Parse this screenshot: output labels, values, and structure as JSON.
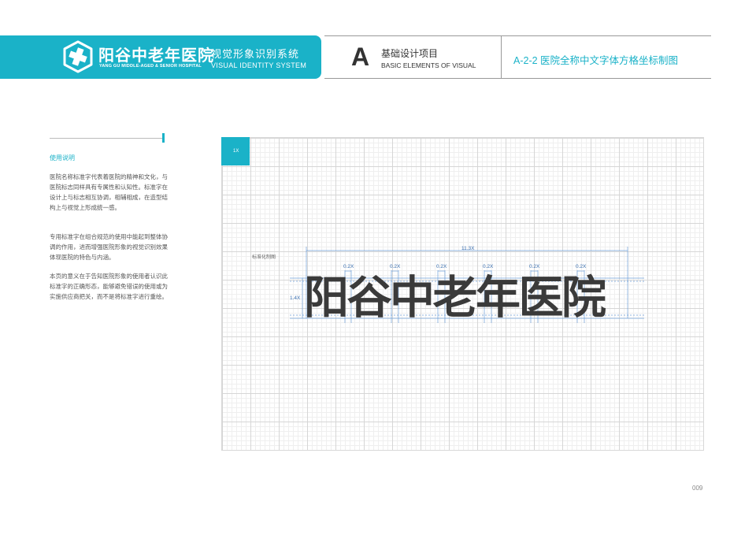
{
  "header": {
    "logo_cn": "阳谷中老年医院",
    "logo_en": "YANG GU MIDDLE-AGED & SENIOR HOSPITAL",
    "system_cn": "视觉形象识别系统",
    "system_en": "VISUAL IDENTITY SYSTEM",
    "section_letter": "A",
    "section_cn": "基础设计项目",
    "section_en": "BASIC ELEMENTS OF VISUAL",
    "page_title": "A-2-2 医院全称中文字体方格坐标制图"
  },
  "description": {
    "title": "使用说明",
    "paragraphs": [
      "医院名称标准字代表着医院的精神和文化，与医院标志同样具有专属性和认知性。标准字在设计上与标志相互协调，相辅相成，在造型结构上与视觉上形成统一感。",
      "专用标准字在组合规范的使用中能起到整体协调的作用，进而增强医院形象的视觉识别效果体现医院的特色与内涵。",
      "本页的意义在于告知医院形象的使用者认识此标准字的正确形态，能够避免错误的使用或为实施供应商把关，而不是将标准字进行重绘。"
    ]
  },
  "grid": {
    "unit_label": "1X",
    "standard_label": "标准化制图",
    "width_label": "11.3X",
    "height_label": "1.4X",
    "gap_labels": [
      "0.2X",
      "0.2X",
      "0.2X",
      "0.2X",
      "0.2X",
      "0.2X"
    ],
    "name_text": "阳谷中老年医院"
  },
  "colors": {
    "brand": "#1ab2c8",
    "dimension": "#3a6fb0"
  },
  "page_number": "009"
}
